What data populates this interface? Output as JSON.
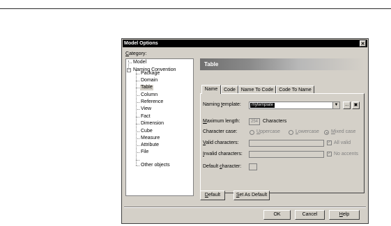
{
  "dialog": {
    "title": "Model Options",
    "close_glyph": "✕"
  },
  "category": {
    "label_u": "C",
    "label_rest": "ategory:",
    "items": [
      {
        "label": "Model"
      },
      {
        "label": "Naming Convention",
        "expander": "−"
      },
      {
        "label": "Package"
      },
      {
        "label": "Domain"
      },
      {
        "label": "Table",
        "selected": true
      },
      {
        "label": "Column"
      },
      {
        "label": "Reference"
      },
      {
        "label": "View"
      },
      {
        "label": "Fact"
      },
      {
        "label": "Dimension"
      },
      {
        "label": "Cube"
      },
      {
        "label": "Measure"
      },
      {
        "label": "Attribute"
      },
      {
        "label": "File"
      },
      {
        "label": "Other objects"
      }
    ]
  },
  "section_header": "Table",
  "tabs": [
    {
      "label": "Name",
      "active": true
    },
    {
      "label": "Code"
    },
    {
      "label": "Name To Code"
    },
    {
      "label": "Code To Name"
    }
  ],
  "form": {
    "naming_template_label_a": "Naming ",
    "naming_template_label_u": "t",
    "naming_template_label_b": "emplate:",
    "naming_template_value": "mytemplate",
    "dropdown_glyph": "▼",
    "ellipsis_label": "...",
    "props_icon_glyph": "▣",
    "max_length_label_u": "M",
    "max_length_label_rest": "aximum length:",
    "max_length_value": "254",
    "characters_label": "Characters",
    "character_case_label": "Character case:",
    "case_options": [
      {
        "u": "U",
        "rest": "ppercase",
        "checked": false
      },
      {
        "u": "L",
        "rest": "owercase",
        "checked": false
      },
      {
        "u": "M",
        "rest": "ixed case",
        "checked": true
      }
    ],
    "valid_chars_label_u": "V",
    "valid_chars_label_rest": "alid characters:",
    "all_valid_label": "All valid",
    "invalid_chars_label_u": "I",
    "invalid_chars_label_rest": "nvalid characters:",
    "no_accents_label": "No accents",
    "default_char_label_a": "Default ",
    "default_char_label_u": "c",
    "default_char_label_b": "haracter:",
    "check_glyph": "✓"
  },
  "buttons": {
    "default_u": "D",
    "default_rest": "efault",
    "set_default_u": "S",
    "set_default_rest": "et As Default",
    "ok": "OK",
    "cancel": "Cancel",
    "help_u": "H",
    "help_rest": "elp"
  }
}
